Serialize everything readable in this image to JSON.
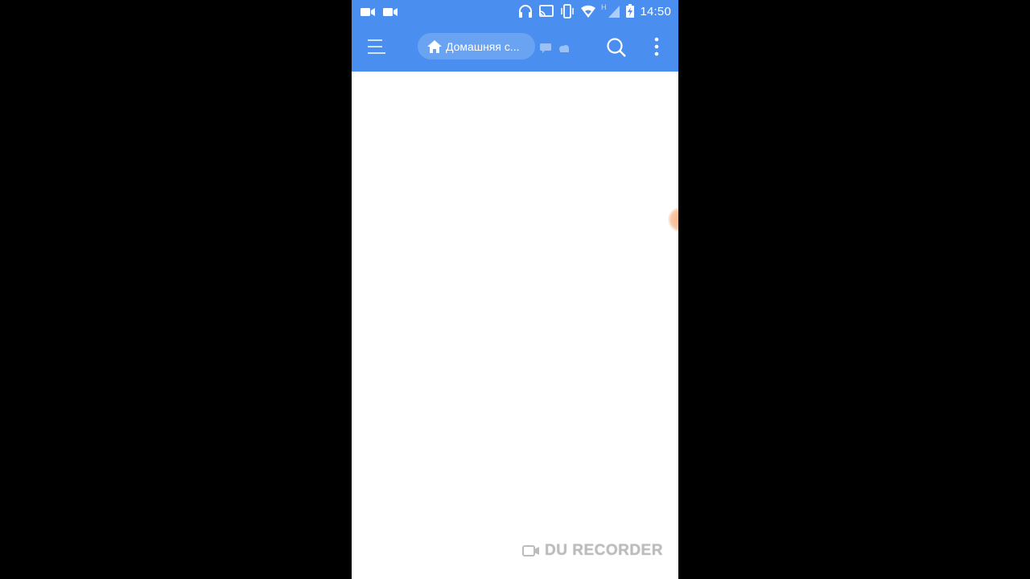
{
  "status_bar": {
    "left_icons": [
      "video-camera-icon",
      "video-camera-icon"
    ],
    "right_icons": [
      "headphones-icon",
      "cast-icon",
      "vibrate-icon",
      "wifi-icon",
      "signal-icon",
      "battery-charging-icon"
    ],
    "network_type": "H",
    "time": "14:50"
  },
  "toolbar": {
    "menu_icon": "hamburger-menu-icon",
    "breadcrumb_icon": "home-icon",
    "breadcrumb_label": "Домашняя с...",
    "extra_icons": [
      "chat-icon",
      "cloud-icon"
    ],
    "search_icon": "search-icon",
    "more_icon": "more-vertical-icon"
  },
  "content": {
    "side_handle_color": "#f7b58a"
  },
  "watermark": {
    "text": "DU RECORDER"
  },
  "colors": {
    "accent": "#4a8ff0",
    "background": "#ffffff",
    "letterbox": "#000000"
  }
}
